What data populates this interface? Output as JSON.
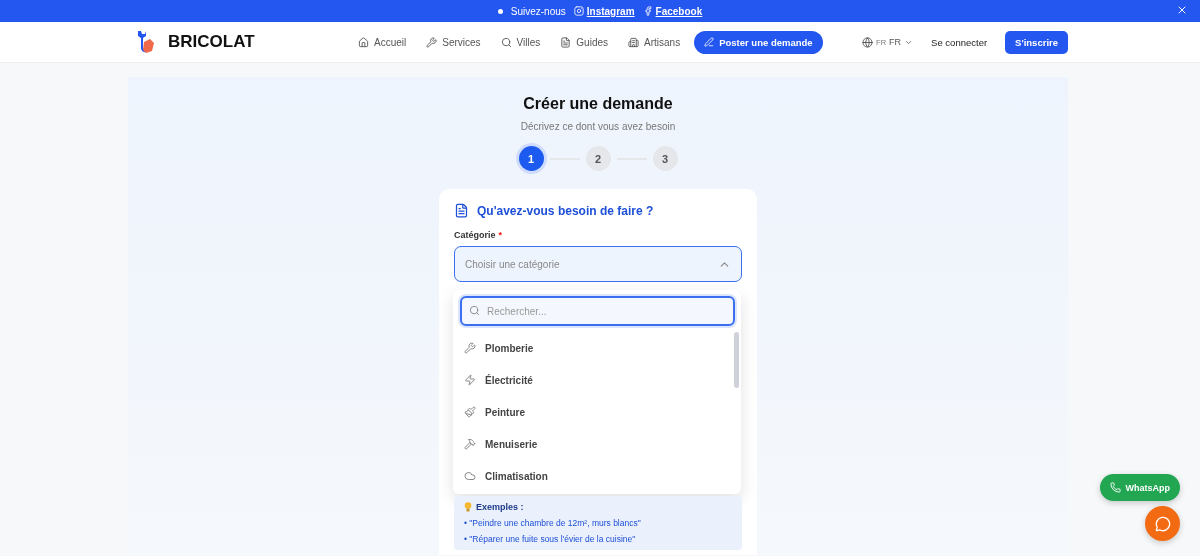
{
  "announcement": {
    "text": "Suivez-nous",
    "links": [
      "Instagram",
      "Facebook"
    ]
  },
  "header": {
    "brand": "BRICOLAT",
    "nav": [
      {
        "label": "Accueil"
      },
      {
        "label": "Services"
      },
      {
        "label": "Villes"
      },
      {
        "label": "Guides"
      },
      {
        "label": "Artisans"
      }
    ],
    "cta": "Poster une demande",
    "language": {
      "code": "FR",
      "label": "FR"
    },
    "login": "Se connecter",
    "signup": "S'inscrire"
  },
  "page": {
    "title": "Créer une demande",
    "subtitle": "Décrivez ce dont vous avez besoin"
  },
  "steps": [
    {
      "label": "1",
      "selected": true
    },
    {
      "label": "2",
      "selected": false
    },
    {
      "label": "3",
      "selected": false
    }
  ],
  "card": {
    "heading": "Qu'avez-vous besoin de faire ?",
    "category_label": "Catégorie",
    "required_mark": "*",
    "select": {
      "placeholder": "Choisir une catégorie",
      "expanded": true
    },
    "dropdown": {
      "search_placeholder": "Rechercher...",
      "options": [
        {
          "label": "Plomberie"
        },
        {
          "label": "Électricité"
        },
        {
          "label": "Peinture"
        },
        {
          "label": "Menuiserie"
        },
        {
          "label": "Climatisation"
        }
      ]
    },
    "examples": {
      "title": "Exemples :",
      "items": [
        "• \"Peindre une chambre de 12m², murs blancs\"",
        "• \"Réparer une fuite sous l'évier de la cuisine\""
      ]
    }
  },
  "floating": {
    "whatsapp": "WhatsApp"
  }
}
